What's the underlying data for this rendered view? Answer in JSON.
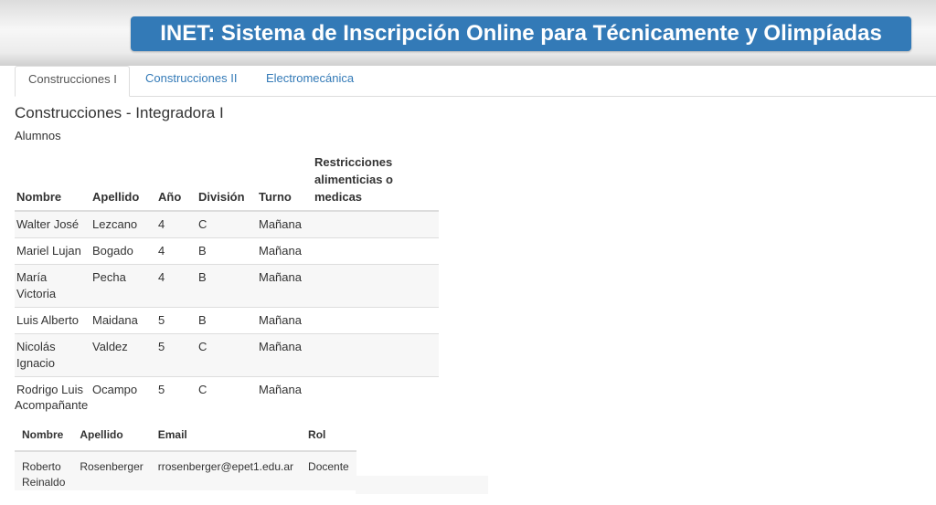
{
  "header": {
    "title": "INET: Sistema de Inscripción Online para Técnicamente y Olimpíadas"
  },
  "tabs": [
    {
      "label": "Construcciones I",
      "active": true
    },
    {
      "label": "Construcciones II",
      "active": false
    },
    {
      "label": "Electromecánica",
      "active": false
    }
  ],
  "section": {
    "title": "Construcciones - Integradora I"
  },
  "students": {
    "label": "Alumnos",
    "headers": [
      "Nombre",
      "Apellido",
      "Año",
      "División",
      "Turno",
      "Restricciones alimenticias o medicas"
    ],
    "rows": [
      [
        "Walter José",
        "Lezcano",
        "4",
        "C",
        "Mañana",
        ""
      ],
      [
        "Mariel Lujan",
        "Bogado",
        "4",
        "B",
        "Mañana",
        ""
      ],
      [
        "María Victoria",
        "Pecha",
        "4",
        "B",
        "Mañana",
        ""
      ],
      [
        "Luis Alberto",
        "Maidana",
        "5",
        "B",
        "Mañana",
        ""
      ],
      [
        "Nicolás Ignacio",
        "Valdez",
        "5",
        "C",
        "Mañana",
        ""
      ],
      [
        "Rodrigo Luis",
        "Ocampo",
        "5",
        "C",
        "Mañana",
        ""
      ]
    ]
  },
  "companions": {
    "label": "Acompañante",
    "headers": [
      "Nombre",
      "Apellido",
      "Email",
      "Rol"
    ],
    "rows": [
      [
        "Roberto Reinaldo",
        "Rosenberger",
        "rrosenberger@epet1.edu.ar",
        "Docente"
      ]
    ]
  }
}
